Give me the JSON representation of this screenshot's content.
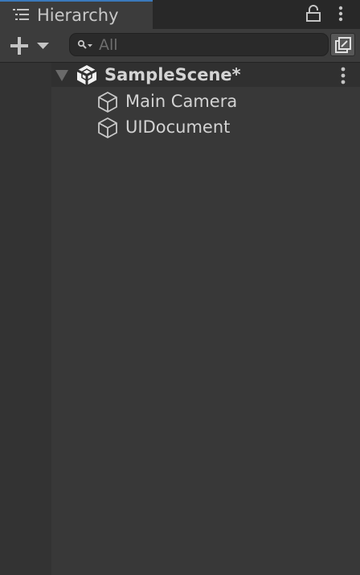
{
  "window": {
    "tab_title": "Hierarchy",
    "tab_icon": "list-icon",
    "menu_icon": "kebab-menu-icon"
  },
  "toolbar": {
    "add_icon": "plus-icon",
    "search": {
      "placeholder": "All",
      "value": ""
    },
    "scene_visibility_icon": "scene-visibility-icon"
  },
  "scene": {
    "name": "SampleScene*",
    "expanded": true,
    "icon": "unity-icon"
  },
  "hierarchy": {
    "items": [
      {
        "label": "Main Camera",
        "icon": "cube-icon"
      },
      {
        "label": "UIDocument",
        "icon": "cube-icon"
      }
    ]
  },
  "colors": {
    "accent": "#3a79bb",
    "panel_bg": "#383838",
    "tab_bar_bg": "#282828",
    "toolbar_bg": "#3c3c3c",
    "search_bg": "#2a2a2a",
    "text": "#d2d2d2"
  }
}
